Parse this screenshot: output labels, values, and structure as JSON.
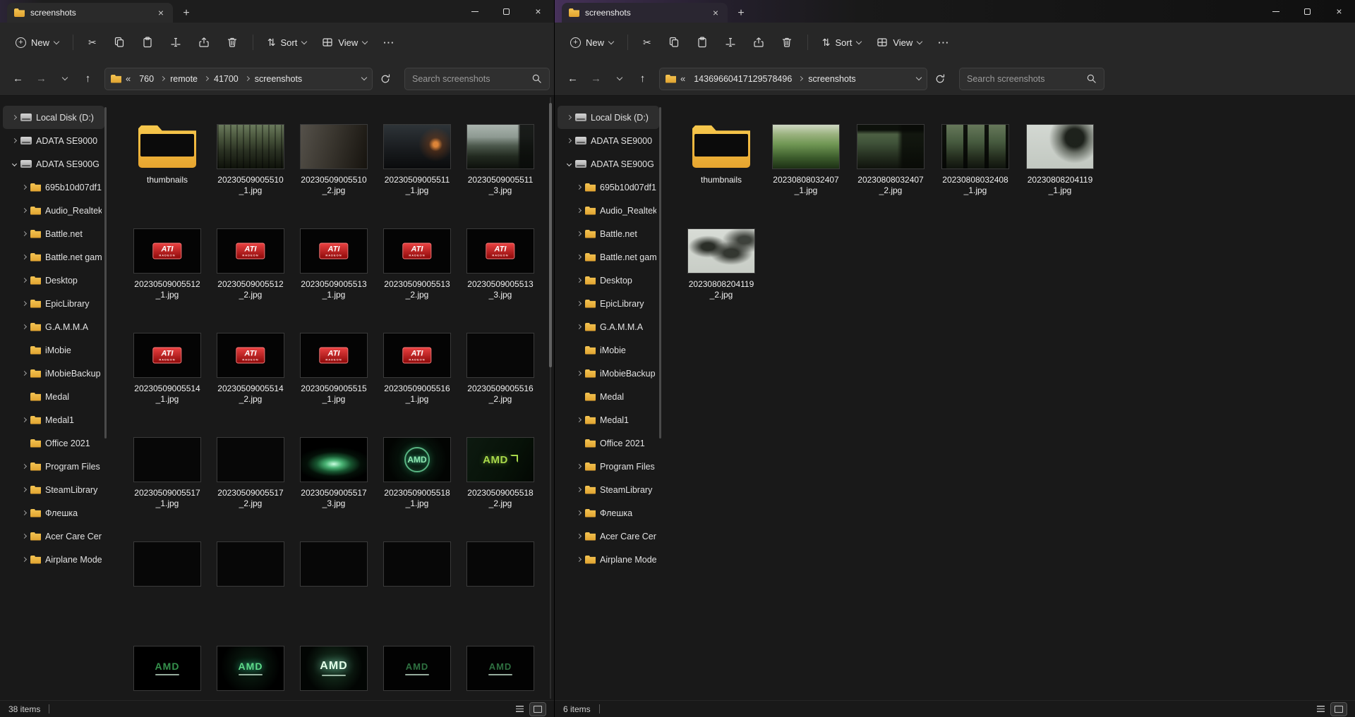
{
  "icons": {
    "close": "×",
    "plus": "+",
    "back": "←",
    "forward": "→",
    "up": "↑",
    "more": "···",
    "sort": "⇅",
    "cut": "✂",
    "overflow": "«"
  },
  "colors": {
    "folder_yellow": "#f2c04c",
    "ati_red": "#c01414",
    "amd_green": "#46b269",
    "mica_purple": "#46315a"
  },
  "toolbar": {
    "new_label": "New",
    "sort_label": "Sort",
    "view_label": "View"
  },
  "search_placeholder": "Search screenshots",
  "sidebar_items": [
    {
      "chevron": "right",
      "icon": "drive",
      "label": "Local Disk (D:)",
      "level": "lv0",
      "state": "selected"
    },
    {
      "chevron": "right",
      "icon": "drive",
      "label": "ADATA SE9000",
      "level": "lv0",
      "state": ""
    },
    {
      "chevron": "down",
      "icon": "drive",
      "label": "ADATA SE900G",
      "level": "lv0",
      "state": ""
    },
    {
      "chevron": "right",
      "icon": "folder",
      "label": "695b10d07df1",
      "level": "lv1",
      "state": ""
    },
    {
      "chevron": "right",
      "icon": "folder",
      "label": "Audio_Realtek",
      "level": "lv1",
      "state": ""
    },
    {
      "chevron": "right",
      "icon": "folder",
      "label": "Battle.net",
      "level": "lv1",
      "state": ""
    },
    {
      "chevron": "right",
      "icon": "folder",
      "label": "Battle.net gam",
      "level": "lv1",
      "state": ""
    },
    {
      "chevron": "right",
      "icon": "folder",
      "label": "Desktop",
      "level": "lv1",
      "state": ""
    },
    {
      "chevron": "right",
      "icon": "folder",
      "label": "EpicLibrary",
      "level": "lv1",
      "state": ""
    },
    {
      "chevron": "right",
      "icon": "folder",
      "label": "G.A.M.M.A",
      "level": "lv1",
      "state": ""
    },
    {
      "chevron": "none",
      "icon": "folder",
      "label": "iMobie",
      "level": "lv1",
      "state": ""
    },
    {
      "chevron": "right",
      "icon": "folder",
      "label": "iMobieBackup",
      "level": "lv1",
      "state": ""
    },
    {
      "chevron": "none",
      "icon": "folder",
      "label": "Medal",
      "level": "lv1",
      "state": ""
    },
    {
      "chevron": "right",
      "icon": "folder",
      "label": "Medal1",
      "level": "lv1",
      "state": ""
    },
    {
      "chevron": "none",
      "icon": "folder",
      "label": "Office 2021",
      "level": "lv1",
      "state": ""
    },
    {
      "chevron": "right",
      "icon": "folder",
      "label": "Program Files (",
      "level": "lv1",
      "state": ""
    },
    {
      "chevron": "right",
      "icon": "folder",
      "label": "SteamLibrary",
      "level": "lv1",
      "state": ""
    },
    {
      "chevron": "right",
      "icon": "folder",
      "label": "Флешка",
      "level": "lv1",
      "state": ""
    },
    {
      "chevron": "right",
      "icon": "folder",
      "label": "Acer Care Cent",
      "level": "lv1",
      "state": ""
    },
    {
      "chevron": "right",
      "icon": "folder",
      "label": "Airplane Mode",
      "level": "lv1",
      "state": ""
    }
  ],
  "left": {
    "tab_title": "screenshots",
    "crumbs": [
      {
        "label": "760"
      },
      {
        "label": "remote"
      },
      {
        "label": "41700"
      },
      {
        "label": "screenshots"
      }
    ],
    "status_count": "38 items",
    "files": [
      {
        "label": "thumbnails",
        "thumb": "folder"
      },
      {
        "label": "20230509005510_1.jpg",
        "thumb": "scene-forest"
      },
      {
        "label": "20230509005510_2.jpg",
        "thumb": "scene-dusk"
      },
      {
        "label": "20230509005511_1.jpg",
        "thumb": "scene-night-city"
      },
      {
        "label": "20230509005511_3.jpg",
        "thumb": "scene-bridge"
      },
      {
        "label": "20230509005512_1.jpg",
        "thumb": "ati",
        "badge": "ATI",
        "badge2": "RADEON"
      },
      {
        "label": "20230509005512_2.jpg",
        "thumb": "ati",
        "badge": "ATI",
        "badge2": "RADEON"
      },
      {
        "label": "20230509005513_1.jpg",
        "thumb": "ati",
        "badge": "ATI",
        "badge2": "RADEON"
      },
      {
        "label": "20230509005513_2.jpg",
        "thumb": "ati",
        "badge": "ATI",
        "badge2": "RADEON"
      },
      {
        "label": "20230509005513_3.jpg",
        "thumb": "ati",
        "badge": "ATI",
        "badge2": "RADEON"
      },
      {
        "label": "20230509005514_1.jpg",
        "thumb": "ati",
        "badge": "ATI",
        "badge2": "RADEON"
      },
      {
        "label": "20230509005514_2.jpg",
        "thumb": "ati",
        "badge": "ATI",
        "badge2": "RADEON"
      },
      {
        "label": "20230509005515_1.jpg",
        "thumb": "ati",
        "badge": "ATI",
        "badge2": "RADEON"
      },
      {
        "label": "20230509005516_1.jpg",
        "thumb": "ati",
        "badge": "ATI",
        "badge2": "RADEON"
      },
      {
        "label": "20230509005516_2.jpg",
        "thumb": "black"
      },
      {
        "label": "20230509005517_1.jpg",
        "thumb": "black"
      },
      {
        "label": "20230509005517_2.jpg",
        "thumb": "black"
      },
      {
        "label": "20230509005517_3.jpg",
        "thumb": "green-dish"
      },
      {
        "label": "20230509005518_1.jpg",
        "thumb": "amd-ring",
        "badge": "AMD"
      },
      {
        "label": "20230509005518_2.jpg",
        "thumb": "amd-logo",
        "badge": "AMD"
      },
      {
        "label": "",
        "thumb": "black"
      },
      {
        "label": "",
        "thumb": "black"
      },
      {
        "label": "",
        "thumb": "black"
      },
      {
        "label": "",
        "thumb": "black"
      },
      {
        "label": "",
        "thumb": "black"
      },
      {
        "label": "",
        "thumb": "amd-splash-a",
        "badge": "AMD"
      },
      {
        "label": "",
        "thumb": "amd-splash-b",
        "badge": "AMD"
      },
      {
        "label": "",
        "thumb": "amd-splash-c",
        "badge": "AMD"
      },
      {
        "label": "",
        "thumb": "amd-splash-d",
        "badge": "AMD"
      },
      {
        "label": "",
        "thumb": "amd-splash-e",
        "badge": "AMD"
      }
    ]
  },
  "right": {
    "tab_title": "screenshots",
    "crumbs": [
      {
        "label": "14369660417129578496"
      },
      {
        "label": "screenshots"
      }
    ],
    "status_count": "6 items",
    "files": [
      {
        "label": "thumbnails",
        "thumb": "folder"
      },
      {
        "label": "20230808032407_1.jpg",
        "thumb": "scene-grass"
      },
      {
        "label": "20230808032407_2.jpg",
        "thumb": "scene-cab"
      },
      {
        "label": "20230808032408_1.jpg",
        "thumb": "scene-cab2"
      },
      {
        "label": "20230808204119_1.jpg",
        "thumb": "scene-branch"
      },
      {
        "label": "20230808204119_2.jpg",
        "thumb": "scene-branches"
      }
    ]
  }
}
